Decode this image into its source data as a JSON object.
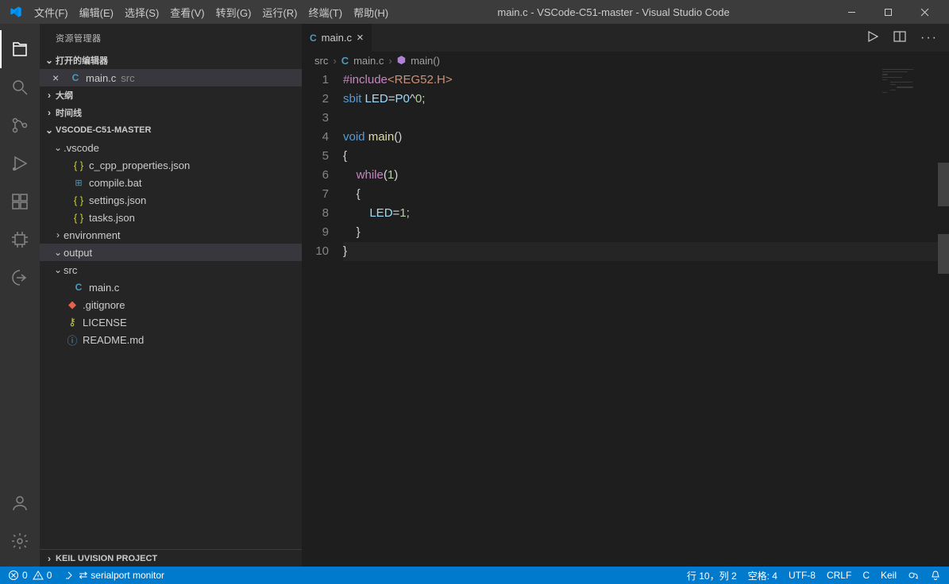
{
  "title": "main.c - VSCode-C51-master - Visual Studio Code",
  "menu": [
    "文件(F)",
    "编辑(E)",
    "选择(S)",
    "查看(V)",
    "转到(G)",
    "运行(R)",
    "终端(T)",
    "帮助(H)"
  ],
  "sidebar": {
    "header": "资源管理器",
    "open_editors_label": "打开的编辑器",
    "outline_label": "大纲",
    "timeline_label": "时间线",
    "project_label": "VSCODE-C51-MASTER",
    "keil_label": "KEIL UVISION PROJECT",
    "open_editors": [
      {
        "name": "main.c",
        "desc": "src"
      }
    ],
    "tree": {
      "vscode_folder": ".vscode",
      "vscode_files": [
        "c_cpp_properties.json",
        "compile.bat",
        "settings.json",
        "tasks.json"
      ],
      "environment": "environment",
      "output": "output",
      "src": "src",
      "src_files": [
        "main.c"
      ],
      "root_files": [
        {
          "name": ".gitignore",
          "icon": "git"
        },
        {
          "name": "LICENSE",
          "icon": "lic"
        },
        {
          "name": "README.md",
          "icon": "md"
        }
      ]
    }
  },
  "tabs": [
    {
      "name": "main.c"
    }
  ],
  "breadcrumb": {
    "folder": "src",
    "file": "main.c",
    "symbol": "main()"
  },
  "code": {
    "line_count": 10,
    "lines": [
      [
        {
          "t": "pp",
          "v": "#include"
        },
        {
          "t": "str",
          "v": "<REG52.H>"
        }
      ],
      [
        {
          "t": "kw",
          "v": "sbit"
        },
        {
          "t": "op",
          "v": " "
        },
        {
          "t": "id",
          "v": "LED"
        },
        {
          "t": "op",
          "v": "="
        },
        {
          "t": "id",
          "v": "P0"
        },
        {
          "t": "op",
          "v": "^"
        },
        {
          "t": "num",
          "v": "0"
        },
        {
          "t": "op",
          "v": ";"
        }
      ],
      [],
      [
        {
          "t": "kw",
          "v": "void"
        },
        {
          "t": "op",
          "v": " "
        },
        {
          "t": "fn",
          "v": "main"
        },
        {
          "t": "op",
          "v": "()"
        }
      ],
      [
        {
          "t": "op",
          "v": "{"
        }
      ],
      [
        {
          "t": "op",
          "v": "    "
        },
        {
          "t": "ctrl",
          "v": "while"
        },
        {
          "t": "op",
          "v": "("
        },
        {
          "t": "num",
          "v": "1"
        },
        {
          "t": "op",
          "v": ")"
        }
      ],
      [
        {
          "t": "op",
          "v": "    {"
        }
      ],
      [
        {
          "t": "op",
          "v": "        "
        },
        {
          "t": "id",
          "v": "LED"
        },
        {
          "t": "op",
          "v": "="
        },
        {
          "t": "num",
          "v": "1"
        },
        {
          "t": "op",
          "v": ";"
        }
      ],
      [
        {
          "t": "op",
          "v": "    }"
        }
      ],
      [
        {
          "t": "op",
          "v": "}"
        }
      ]
    ]
  },
  "status": {
    "errors": "0",
    "warnings": "0",
    "serial": "serialport monitor",
    "pos": "行 10，列 2",
    "spaces": "空格: 4",
    "encoding": "UTF-8",
    "eol": "CRLF",
    "lang": "C",
    "extra": "Keil"
  }
}
